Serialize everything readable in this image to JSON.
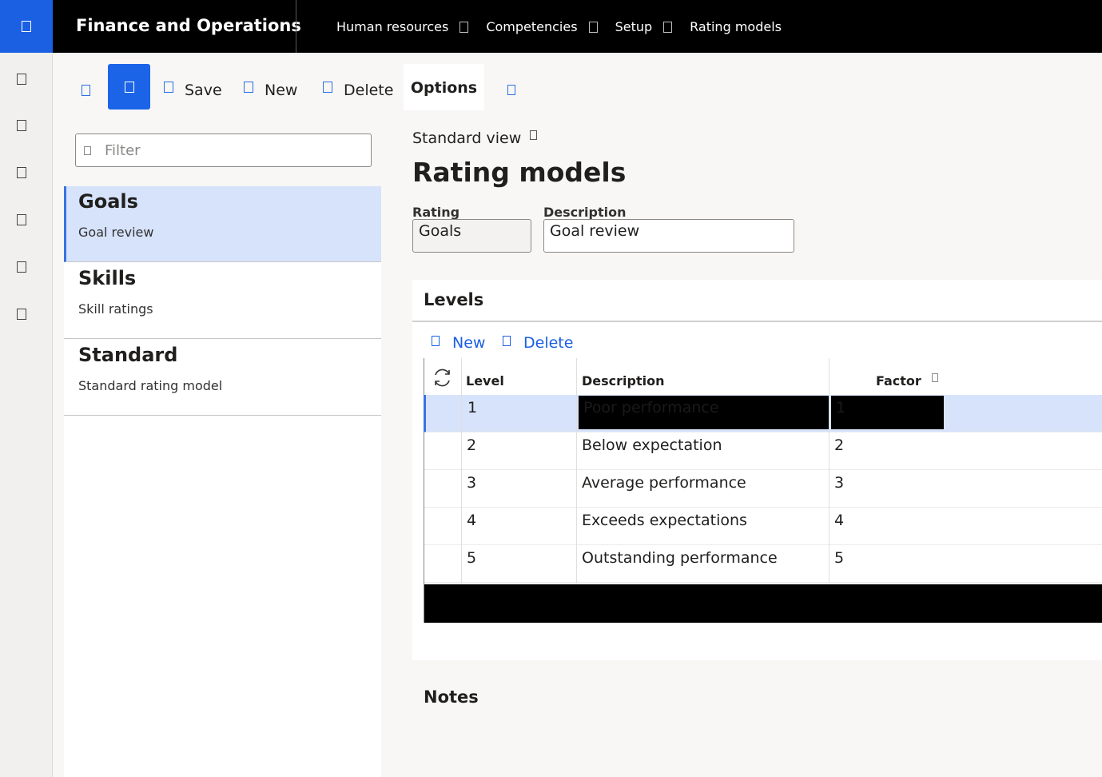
{
  "topbar": {
    "app_title": "Finance and Operations",
    "breadcrumbs": [
      "Human resources",
      "Competencies",
      "Setup",
      "Rating models"
    ]
  },
  "icons": {
    "waffle": "waffle-icon",
    "rail": [
      "home-icon",
      "star-icon",
      "clock-icon",
      "workspace-icon",
      "list-icon",
      "modules-icon"
    ]
  },
  "actionbar": {
    "save_label": "Save",
    "new_label": "New",
    "delete_label": "Delete",
    "options_label": "Options"
  },
  "list": {
    "filter_placeholder": "Filter",
    "items": [
      {
        "title": "Goals",
        "subtitle": "Goal review"
      },
      {
        "title": "Skills",
        "subtitle": "Skill ratings"
      },
      {
        "title": "Standard",
        "subtitle": "Standard rating model"
      }
    ]
  },
  "main": {
    "view_label": "Standard view",
    "page_title": "Rating models",
    "rating_label": "Rating",
    "rating_value": "Goals",
    "description_label": "Description",
    "description_value": "Goal review"
  },
  "levels": {
    "title": "Levels",
    "new_label": "New",
    "delete_label": "Delete",
    "columns": {
      "level": "Level",
      "description": "Description",
      "factor": "Factor"
    },
    "rows": [
      {
        "level": "1",
        "description": "Poor performance",
        "factor": "1"
      },
      {
        "level": "2",
        "description": "Below expectation",
        "factor": "2"
      },
      {
        "level": "3",
        "description": "Average performance",
        "factor": "3"
      },
      {
        "level": "4",
        "description": "Exceeds expectations",
        "factor": "4"
      },
      {
        "level": "5",
        "description": "Outstanding performance",
        "factor": "5"
      }
    ]
  },
  "notes": {
    "title": "Notes"
  },
  "colors": {
    "accent": "#1b64e8",
    "selected_row": "#d6e3fb",
    "topbar": "#000000"
  }
}
